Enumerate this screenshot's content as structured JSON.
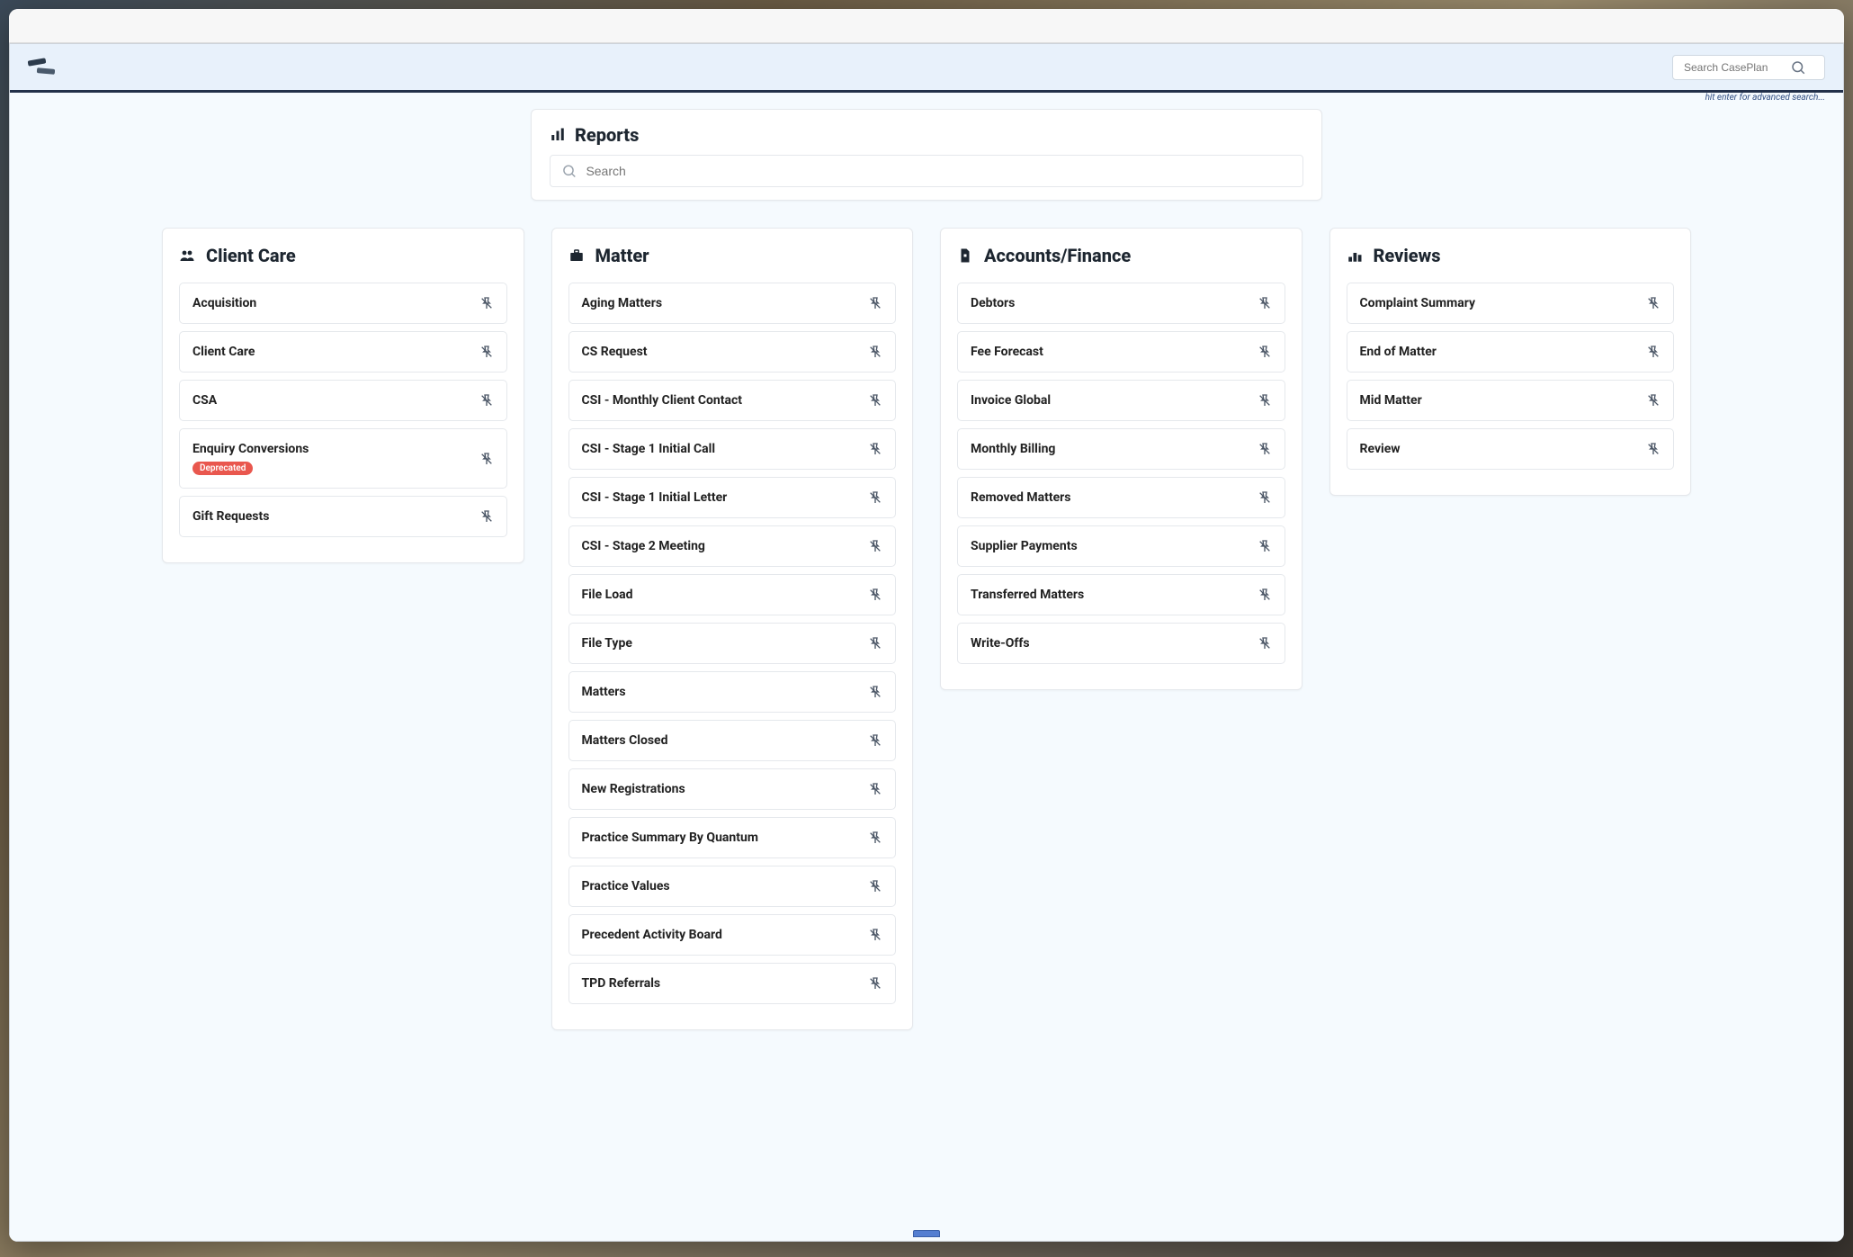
{
  "global_search": {
    "placeholder": "Search CasePlan",
    "hint": "hit enter for advanced search..."
  },
  "page": {
    "title": "Reports",
    "local_search_placeholder": "Search"
  },
  "categories": [
    {
      "id": "client-care",
      "title": "Client Care",
      "icon": "users-icon",
      "items": [
        {
          "label": "Acquisition"
        },
        {
          "label": "Client Care"
        },
        {
          "label": "CSA"
        },
        {
          "label": "Enquiry Conversions",
          "badge": "Deprecated"
        },
        {
          "label": "Gift Requests"
        }
      ]
    },
    {
      "id": "matter",
      "title": "Matter",
      "icon": "briefcase-icon",
      "items": [
        {
          "label": "Aging Matters"
        },
        {
          "label": "CS Request"
        },
        {
          "label": "CSI - Monthly Client Contact"
        },
        {
          "label": "CSI - Stage 1 Initial Call"
        },
        {
          "label": "CSI - Stage 1 Initial Letter"
        },
        {
          "label": "CSI - Stage 2 Meeting"
        },
        {
          "label": "File Load"
        },
        {
          "label": "File Type"
        },
        {
          "label": "Matters"
        },
        {
          "label": "Matters Closed"
        },
        {
          "label": "New Registrations"
        },
        {
          "label": "Practice Summary By Quantum"
        },
        {
          "label": "Practice Values"
        },
        {
          "label": "Precedent Activity Board"
        },
        {
          "label": "TPD Referrals"
        }
      ]
    },
    {
      "id": "accounts-finance",
      "title": "Accounts/Finance",
      "icon": "file-icon",
      "items": [
        {
          "label": "Debtors"
        },
        {
          "label": "Fee Forecast"
        },
        {
          "label": "Invoice Global"
        },
        {
          "label": "Monthly Billing"
        },
        {
          "label": "Removed Matters"
        },
        {
          "label": "Supplier Payments"
        },
        {
          "label": "Transferred Matters"
        },
        {
          "label": "Write-Offs"
        }
      ]
    },
    {
      "id": "reviews",
      "title": "Reviews",
      "icon": "leaderboard-icon",
      "items": [
        {
          "label": "Complaint Summary"
        },
        {
          "label": "End of Matter"
        },
        {
          "label": "Mid Matter"
        },
        {
          "label": "Review"
        }
      ]
    }
  ]
}
